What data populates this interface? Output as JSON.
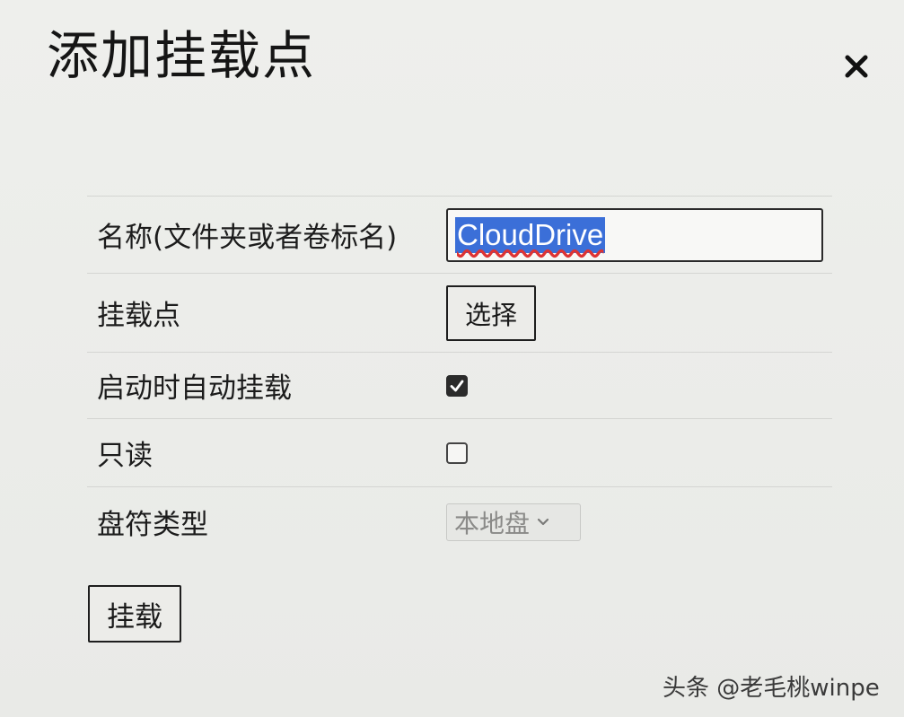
{
  "dialog": {
    "title": "添加挂载点",
    "close_icon": "close-icon"
  },
  "form": {
    "name": {
      "label": "名称(文件夹或者卷标名)",
      "value": "CloudDrive"
    },
    "mount_point": {
      "label": "挂载点",
      "button_label": "选择"
    },
    "auto_mount": {
      "label": "启动时自动挂载",
      "checked": true
    },
    "read_only": {
      "label": "只读",
      "checked": false
    },
    "drive_type": {
      "label": "盘符类型",
      "selected": "本地盘",
      "icon": "chevron-down-icon"
    }
  },
  "actions": {
    "mount_label": "挂载"
  },
  "watermark": {
    "text": "头条 @老毛桃winpe"
  },
  "colors": {
    "selection": "#3b6fd8",
    "background": "#ecedea",
    "border": "#1e1e1e"
  }
}
